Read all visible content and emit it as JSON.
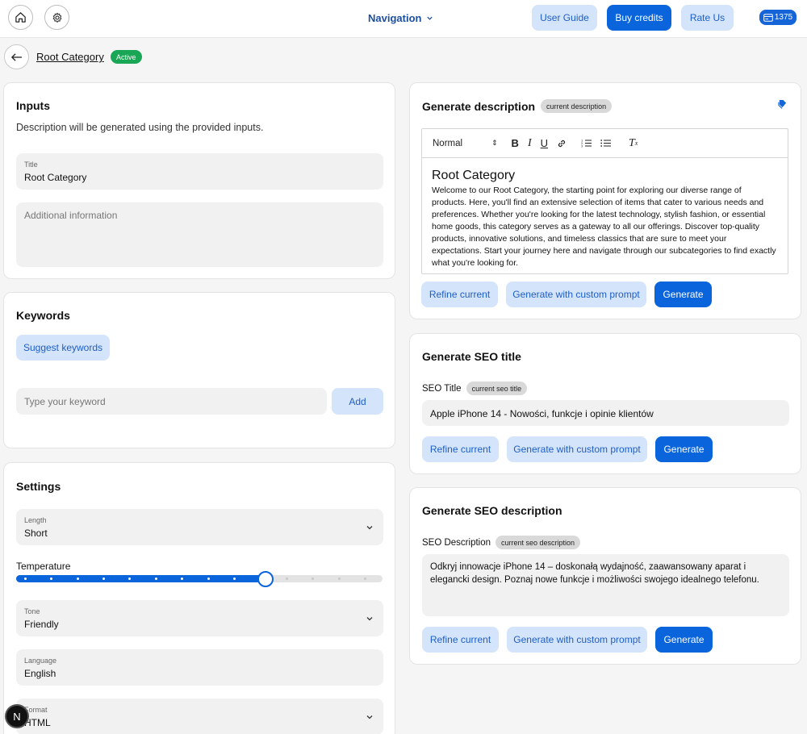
{
  "topbar": {
    "navigation_label": "Navigation",
    "user_guide": "User Guide",
    "buy_credits": "Buy credits",
    "rate_us": "Rate Us",
    "credits": "1375"
  },
  "breadcrumb": {
    "link": "Root Category",
    "badge": "Active"
  },
  "inputs": {
    "title": "Inputs",
    "subtitle": "Description will be generated using the provided inputs.",
    "title_field_label": "Title",
    "title_field_value": "Root Category",
    "additional_placeholder": "Additional information"
  },
  "keywords": {
    "title": "Keywords",
    "suggest": "Suggest keywords",
    "input_placeholder": "Type your keyword",
    "add": "Add"
  },
  "settings": {
    "title": "Settings",
    "length_label": "Length",
    "length_value": "Short",
    "temperature_label": "Temperature",
    "temperature_value": 0.68,
    "tone_label": "Tone",
    "tone_value": "Friendly",
    "language_label": "Language",
    "language_value": "English",
    "format_label": "Format",
    "format_value": "HTML"
  },
  "generate_description": {
    "title": "Generate description",
    "chip": "current description",
    "toolbar_style": "Normal",
    "heading": "Root Category",
    "body": "Welcome to our Root Category, the starting point for exploring our diverse range of products. Here, you'll find an extensive selection of items that cater to various needs and preferences. Whether you're looking for the latest technology, stylish fashion, or essential home goods, this category serves as a gateway to all our offerings. Discover top-quality products, innovative solutions, and timeless classics that are sure to meet your expectations. Start your journey here and navigate through our subcategories to find exactly what you're looking for.",
    "refine": "Refine current",
    "custom": "Generate with custom prompt",
    "generate": "Generate"
  },
  "seo_title": {
    "title": "Generate SEO title",
    "label": "SEO Title",
    "chip": "current seo title",
    "value": "Apple iPhone 14 - Nowości, funkcje i opinie klientów",
    "refine": "Refine current",
    "custom": "Generate with custom prompt",
    "generate": "Generate"
  },
  "seo_description": {
    "title": "Generate SEO description",
    "label": "SEO Description",
    "chip": "current seo description",
    "value": "Odkryj innowacje iPhone 14 – doskonałą wydajność, zaawansowany aparat i elegancki design. Poznaj nowe funkcje i możliwości swojego idealnego telefonu.",
    "refine": "Refine current",
    "custom": "Generate with custom prompt",
    "generate": "Generate"
  },
  "floating_badge": "N",
  "colors": {
    "primary": "#0a64dc",
    "light_button": "#d3e4fb",
    "active_green": "#19a655"
  }
}
